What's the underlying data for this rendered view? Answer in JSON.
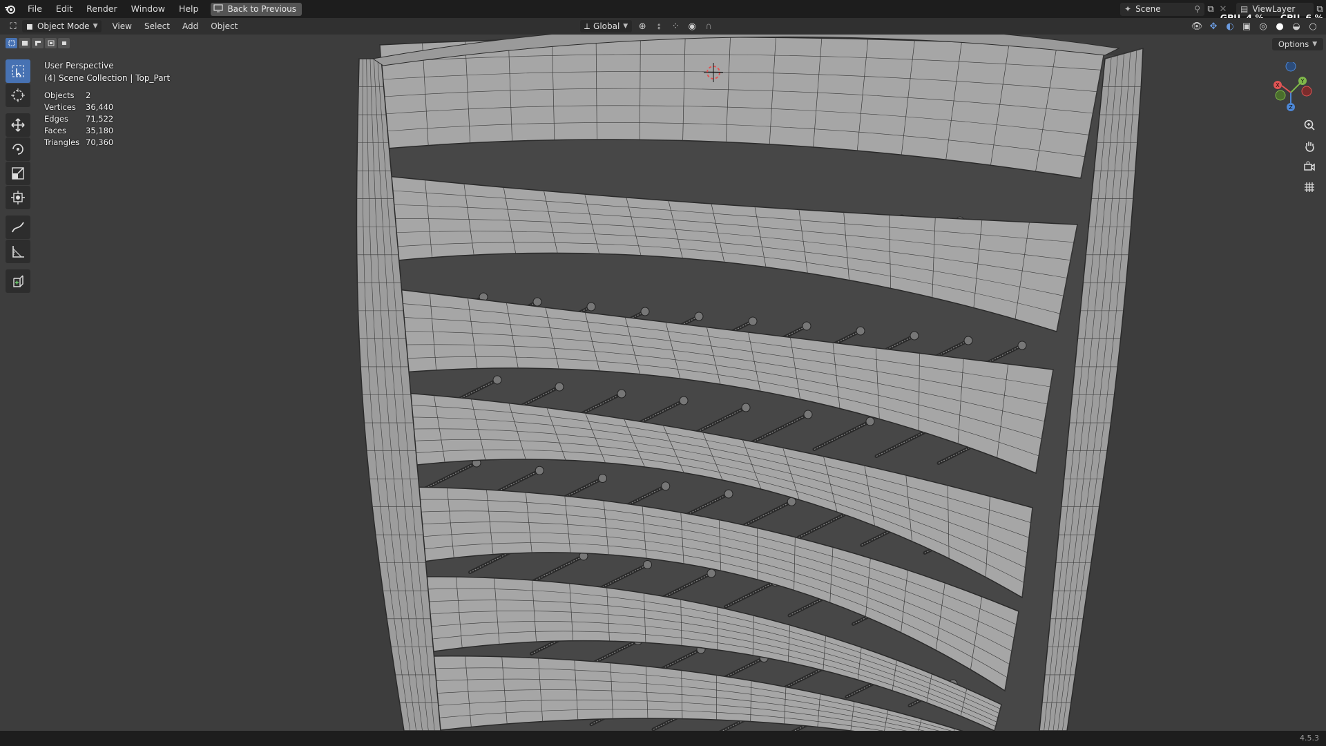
{
  "menu": {
    "items": [
      "File",
      "Edit",
      "Render",
      "Window",
      "Help"
    ],
    "back_label": "Back to Previous"
  },
  "topbar_right": {
    "scene": "Scene",
    "view_layer": "ViewLayer",
    "gpu_label": "GPU",
    "gpu_value": "4 %",
    "cpu_label": "CPU",
    "cpu_value": "6 %"
  },
  "header": {
    "mode": "Object Mode",
    "menus": [
      "View",
      "Select",
      "Add",
      "Object"
    ],
    "orientation": "Global",
    "options": "Options"
  },
  "overlay": {
    "perspective": "User Perspective",
    "collection": "(4) Scene Collection | Top_Part",
    "stats": [
      {
        "label": "Objects",
        "value": "2"
      },
      {
        "label": "Vertices",
        "value": "36,440"
      },
      {
        "label": "Edges",
        "value": "71,522"
      },
      {
        "label": "Faces",
        "value": "35,180"
      },
      {
        "label": "Triangles",
        "value": "70,360"
      }
    ]
  },
  "tools": [
    "select-box-tool",
    "cursor-tool",
    "move-tool",
    "rotate-tool",
    "scale-tool",
    "transform-tool",
    "annotate-tool",
    "measure-tool",
    "add-cube-tool"
  ],
  "gizmo": {
    "x": "X",
    "y": "Y",
    "z": "Z"
  },
  "status": {
    "version": "4.5.3"
  },
  "colors": {
    "accent": "#4772b3",
    "mesh_fill": "#a6a6a6",
    "wire": "#3a3a3a",
    "background": "#3d3d3d"
  }
}
